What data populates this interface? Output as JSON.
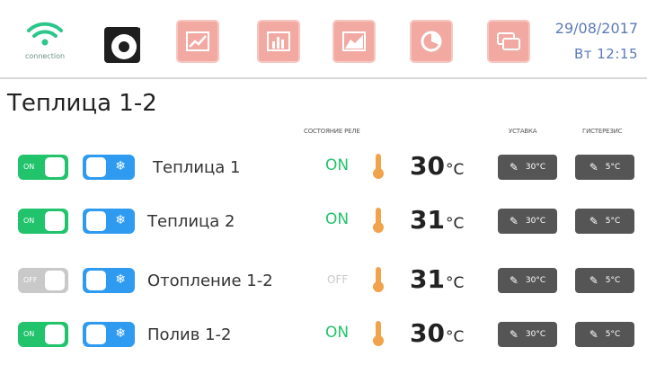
{
  "header": {
    "connection_label": "connection",
    "date": "29/08/2017",
    "time": "Вт  12:15",
    "nav_icons": [
      "line-chart-icon",
      "bar-chart-icon",
      "area-chart-icon",
      "pie-chart-icon",
      "messages-icon"
    ]
  },
  "page": {
    "title": "Теплица 1-2"
  },
  "columns": {
    "relay_state": "СОСТОЯНИЕ РЕЛЕ",
    "setpoint": "УСТАВКА",
    "hysteresis": "ГИСТЕРЕЗИС"
  },
  "rows": [
    {
      "name": "Теплица 1",
      "power_label": "ON",
      "power_on": true,
      "state": "ON",
      "temp": "30",
      "unit": "°C",
      "setpoint": "30°C",
      "hysteresis": "5°C"
    },
    {
      "name": "Теплица 2",
      "power_label": "ON",
      "power_on": true,
      "state": "ON",
      "temp": "31",
      "unit": "°C",
      "setpoint": "30°C",
      "hysteresis": "5°C"
    },
    {
      "name": "Отопление 1-2",
      "power_label": "OFF",
      "power_on": false,
      "state": "OFF",
      "temp": "31",
      "unit": "°C",
      "setpoint": "30°C",
      "hysteresis": "5°C"
    },
    {
      "name": "Полив 1-2",
      "power_label": "ON",
      "power_on": true,
      "state": "ON",
      "temp": "30",
      "unit": "°C",
      "setpoint": "30°C",
      "hysteresis": "5°C"
    }
  ],
  "colors": {
    "on_green": "#21c36b",
    "off_gray": "#c9c9c9",
    "fan_blue": "#2e9bf0",
    "nav_red": "#f2a9a2",
    "thermometer": "#f0a34a",
    "pill": "#555555",
    "date_blue": "#5b7bb8"
  }
}
